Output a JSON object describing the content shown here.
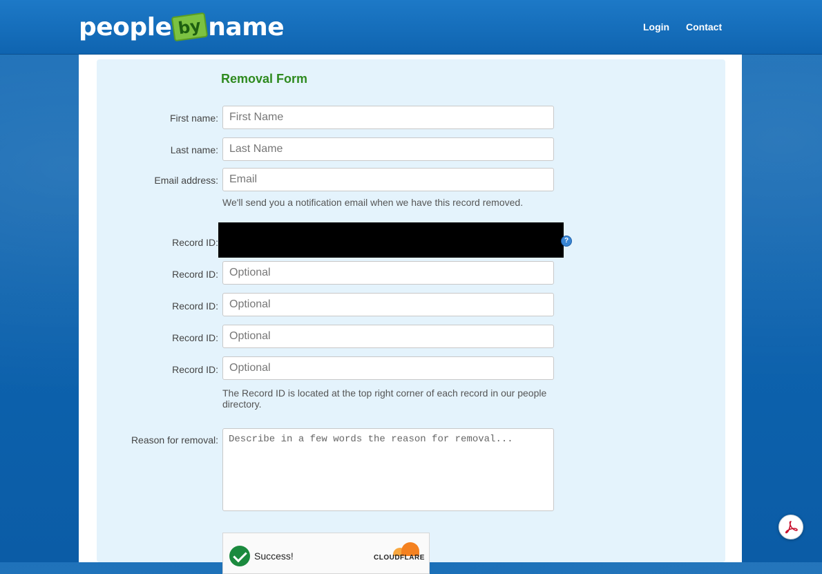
{
  "header": {
    "logo": {
      "word1": "people",
      "word2": "by",
      "word3": "name"
    },
    "nav": {
      "login": "Login",
      "contact": "Contact"
    }
  },
  "form": {
    "title": "Removal Form",
    "first_name": {
      "label": "First name:",
      "placeholder": "First Name",
      "value": ""
    },
    "last_name": {
      "label": "Last name:",
      "placeholder": "Last Name",
      "value": ""
    },
    "email": {
      "label": "Email address:",
      "placeholder": "Email",
      "value": "",
      "help": "We'll send you a notification email when we have this record removed."
    },
    "record_ids": [
      {
        "label": "Record ID:",
        "placeholder": "",
        "redacted": true
      },
      {
        "label": "Record ID:",
        "placeholder": "Optional"
      },
      {
        "label": "Record ID:",
        "placeholder": "Optional"
      },
      {
        "label": "Record ID:",
        "placeholder": "Optional"
      },
      {
        "label": "Record ID:",
        "placeholder": "Optional"
      }
    ],
    "record_help": "The Record ID is located at the top right corner of each record in our people directory.",
    "reason": {
      "label": "Reason for removal:",
      "placeholder": "Describe in a few words the reason for removal..."
    },
    "captcha": {
      "status": "Success!",
      "provider": "CLOUDFLARE"
    }
  },
  "icons": {
    "help": "question-mark-icon",
    "pdf": "adobe-pdf-icon",
    "captcha_check": "checkmark-icon"
  },
  "colors": {
    "header_blue": "#1565b3",
    "panel_bg": "#e4f3fc",
    "title_green": "#2e8a1f",
    "logo_green": "#7cc242"
  }
}
